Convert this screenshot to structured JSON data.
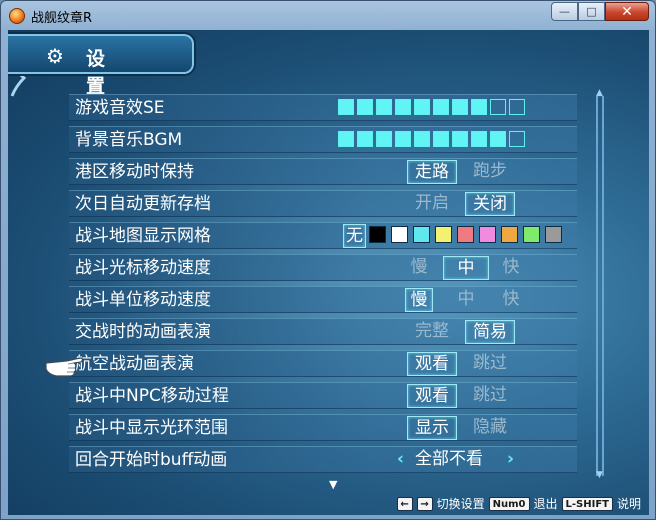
{
  "window": {
    "title": "战舰纹章R",
    "minimize": "—",
    "maximize": "□",
    "close": "✕"
  },
  "header": {
    "title": "设 置"
  },
  "settings": [
    {
      "label": "游戏音效SE",
      "type": "bar",
      "level": 8,
      "max": 10
    },
    {
      "label": "背景音乐BGM",
      "type": "bar",
      "level": 9,
      "max": 10
    },
    {
      "label": "港区移动时保持",
      "type": "options",
      "options": [
        "走路",
        "跑步"
      ],
      "selected": 0
    },
    {
      "label": "次日自动更新存档",
      "type": "options",
      "options": [
        "开启",
        "关闭"
      ],
      "selected": 1
    },
    {
      "label": "战斗地图显示网格",
      "type": "colors",
      "none_label": "无",
      "selected": 0,
      "colors": [
        "#000000",
        "#ffffff",
        "#5fe8f0",
        "#f4f070",
        "#ef7a82",
        "#f08be0",
        "#f0a840",
        "#80ea6a",
        "#9a9a9a"
      ]
    },
    {
      "label": "战斗光标移动速度",
      "type": "options",
      "options": [
        "慢",
        "中",
        "快"
      ],
      "selected": 1
    },
    {
      "label": "战斗单位移动速度",
      "type": "options",
      "options": [
        "慢",
        "中",
        "快"
      ],
      "selected": 0
    },
    {
      "label": "交战时的动画表演",
      "type": "options",
      "options": [
        "完整",
        "简易"
      ],
      "selected": 1
    },
    {
      "label": "航空战动画表演",
      "type": "options",
      "options": [
        "观看",
        "跳过"
      ],
      "selected": 0
    },
    {
      "label": "战斗中NPC移动过程",
      "type": "options",
      "options": [
        "观看",
        "跳过"
      ],
      "selected": 0
    },
    {
      "label": "战斗中显示光环范围",
      "type": "options",
      "options": [
        "显示",
        "隐藏"
      ],
      "selected": 0
    },
    {
      "label": "回合开始时buff动画",
      "type": "cycle",
      "value": "全部不看",
      "left": "‹",
      "right": "›"
    }
  ],
  "cursor_row": 7,
  "footer": {
    "switch_label": "切换设置",
    "exit_key": "Num0",
    "exit_label": "退出",
    "help_key": "L-SHIFT",
    "help_label": "说明",
    "left_key": "←",
    "right_key": "→"
  },
  "icons": {
    "pointer": "pointing-hand-icon",
    "gear": "gear-icon",
    "more": "▼",
    "scroll_up": "▲",
    "scroll_down": "▼"
  }
}
